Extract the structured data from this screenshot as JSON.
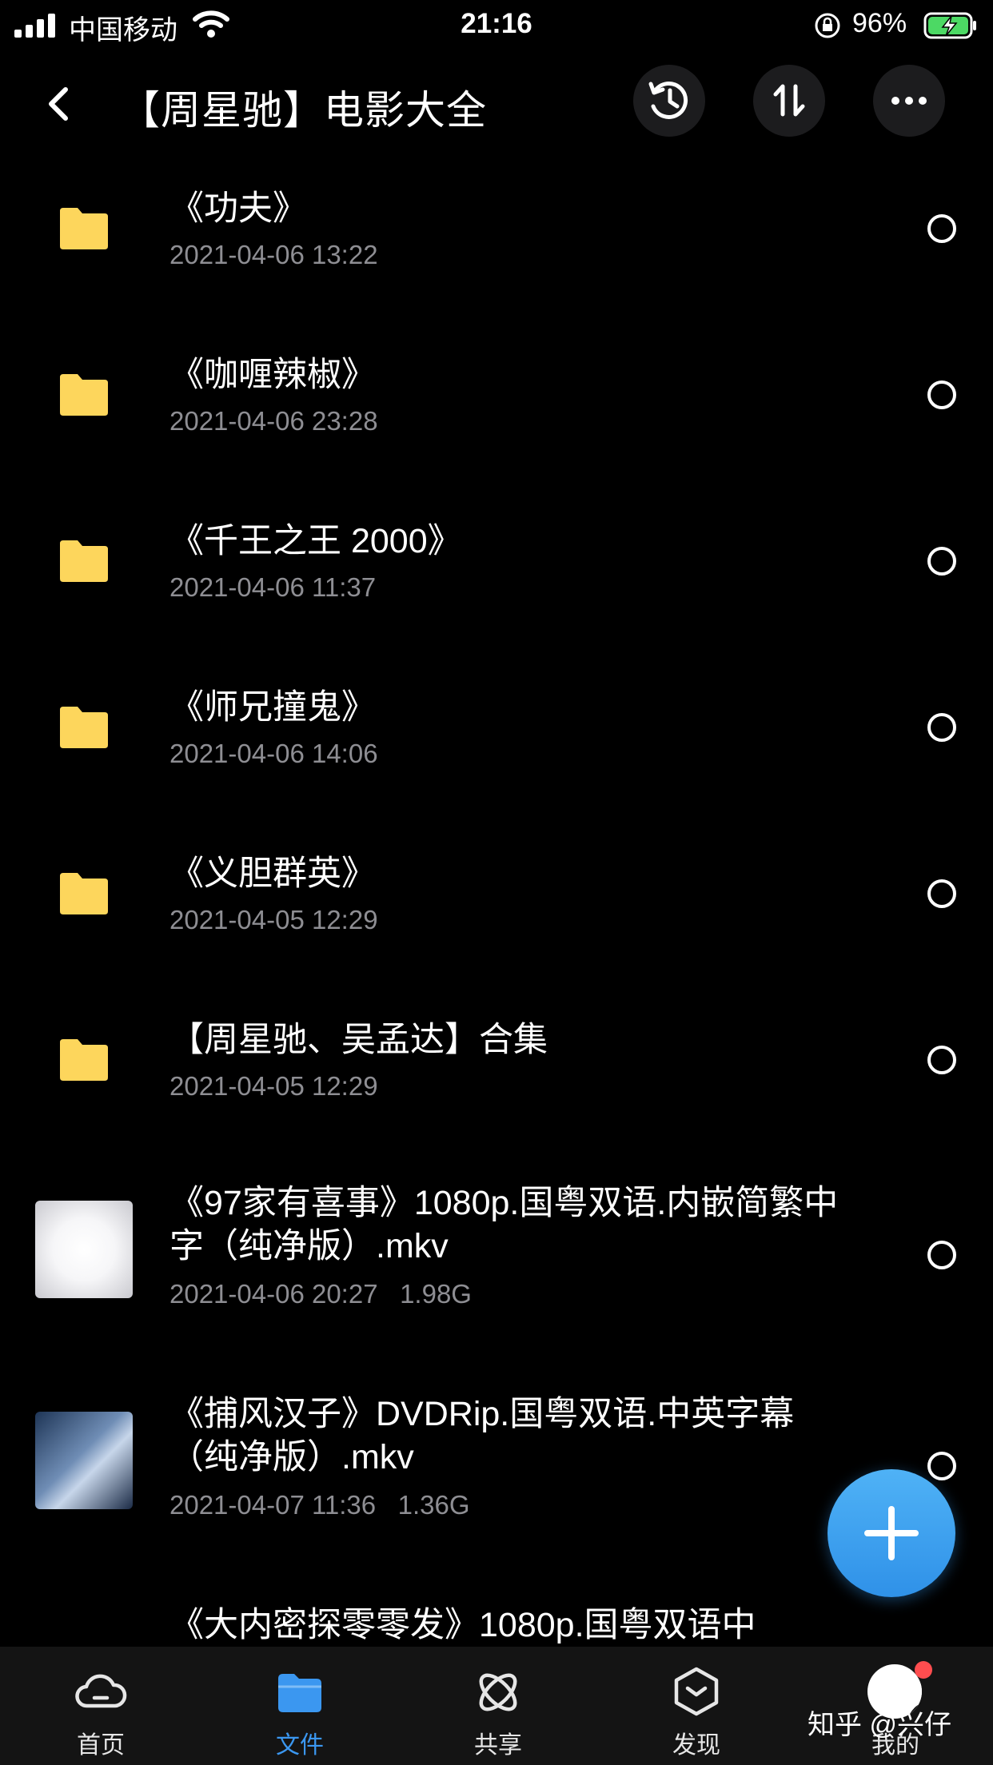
{
  "status_bar": {
    "carrier": "中国移动",
    "time": "21:16",
    "battery_percent": "96%"
  },
  "header": {
    "title": "【周星驰】电影大全"
  },
  "files": [
    {
      "type": "folder",
      "name": "《功夫》",
      "date": "2021-04-06 13:22",
      "size": ""
    },
    {
      "type": "folder",
      "name": "《咖喱辣椒》",
      "date": "2021-04-06 23:28",
      "size": ""
    },
    {
      "type": "folder",
      "name": "《千王之王 2000》",
      "date": "2021-04-06 11:37",
      "size": ""
    },
    {
      "type": "folder",
      "name": "《师兄撞鬼》",
      "date": "2021-04-06 14:06",
      "size": ""
    },
    {
      "type": "folder",
      "name": "《义胆群英》",
      "date": "2021-04-05 12:29",
      "size": ""
    },
    {
      "type": "folder",
      "name": "【周星驰、吴孟达】合集",
      "date": "2021-04-05 12:29",
      "size": ""
    },
    {
      "type": "video",
      "name": "《97家有喜事》1080p.国粤双语.内嵌简繁中字（纯净版）.mkv",
      "date": "2021-04-06 20:27",
      "size": "1.98G"
    },
    {
      "type": "video",
      "name": "《捕风汉子》DVDRip.国粤双语.中英字幕（纯净版）.mkv",
      "date": "2021-04-07 11:36",
      "size": "1.36G"
    },
    {
      "type": "video",
      "name": "《大内密探零零发》1080p.国粤双语中",
      "date": "",
      "size": ""
    }
  ],
  "tabs": [
    {
      "label": "首页",
      "icon": "cloud-icon",
      "active": false
    },
    {
      "label": "文件",
      "icon": "folder-icon",
      "active": true
    },
    {
      "label": "共享",
      "icon": "share-icon",
      "active": false
    },
    {
      "label": "发现",
      "icon": "discover-icon",
      "active": false
    },
    {
      "label": "我的",
      "icon": "avatar",
      "active": false
    }
  ],
  "watermark": "知乎 @兴仔",
  "colors": {
    "accent": "#3b97f0",
    "folder": "#fdd65c",
    "background": "#000000",
    "secondary_text": "#8e8e93",
    "tab_bar": "#141414"
  }
}
